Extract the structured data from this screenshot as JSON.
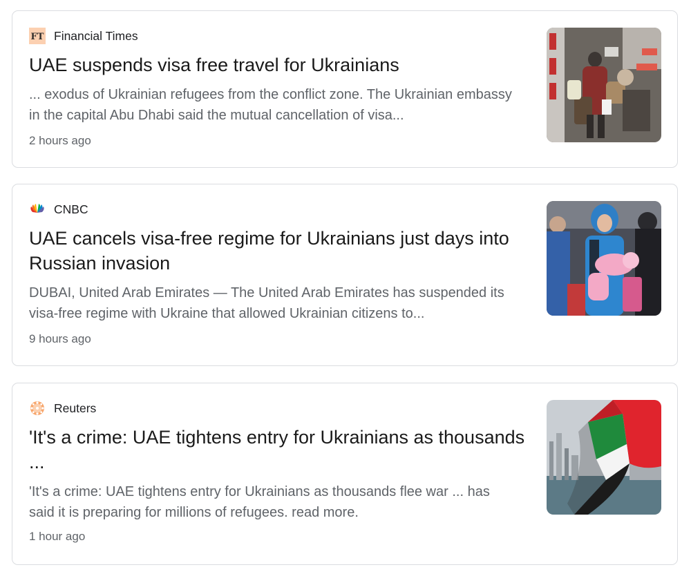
{
  "articles": [
    {
      "source": "Financial Times",
      "logo_text": "FT",
      "logo_icon": "ft-logo-icon",
      "title": "UAE suspends visa free travel for Ukrainians",
      "snippet_lines": [
        "... exodus of Ukrainian refugees from the conflict zone. The Ukrainian embassy",
        "in the capital Abu Dhabi said the mutual cancellation of visa..."
      ],
      "time": "2 hours ago",
      "thumbnail_icon": "refugees-with-luggage-photo"
    },
    {
      "source": "CNBC",
      "logo_icon": "cnbc-peacock-icon",
      "title_lines": [
        "UAE cancels visa-free regime for Ukrainians just days into",
        "Russian invasion"
      ],
      "snippet_lines": [
        "DUBAI, United Arab Emirates — The United Arab Emirates has suspended its",
        "visa-free regime with Ukraine that allowed Ukrainian citizens to..."
      ],
      "time": "9 hours ago",
      "thumbnail_icon": "woman-carrying-baby-photo"
    },
    {
      "source": "Reuters",
      "logo_icon": "reuters-dots-icon",
      "title_lines": [
        "'It's a crime: UAE tightens entry for Ukrainians as thousands",
        "..."
      ],
      "snippet_lines": [
        "'It's a crime: UAE tightens entry for Ukrainians as thousands flee war ... has",
        "said it is preparing for millions of refugees. read more."
      ],
      "time": "1 hour ago",
      "thumbnail_icon": "uae-flag-photo"
    }
  ],
  "colors": {
    "border": "#dadce0",
    "title": "#1a1a1a",
    "meta": "#5f6368",
    "ft_bg": "#fcd0b1",
    "uae_red": "#e0242d",
    "uae_green": "#1f8a3c"
  }
}
